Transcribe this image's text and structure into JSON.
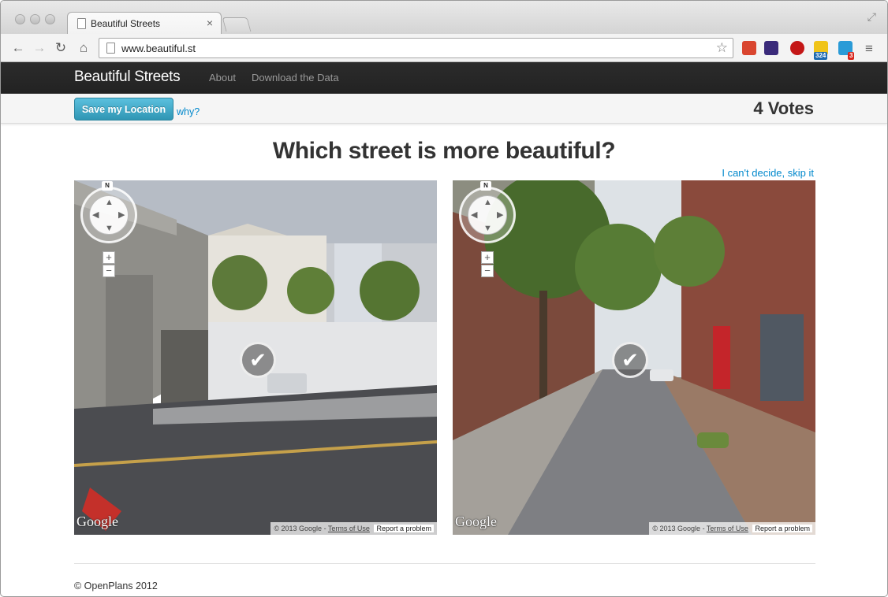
{
  "browser": {
    "tab_title": "Beautiful Streets",
    "tab_close": "×",
    "url": "www.beautiful.st",
    "icons": [
      "back-icon",
      "forward-icon",
      "reload-icon",
      "home-icon",
      "star-icon",
      "menu-icon"
    ],
    "extension_badges": {
      "ext4": "324",
      "ext5": "3"
    }
  },
  "site": {
    "brand": "Beautiful Streets",
    "nav": {
      "about": "About",
      "download": "Download the Data"
    },
    "save_button": "Save my Location",
    "why_link": "why?",
    "votes": "4 Votes",
    "heading": "Which street is more beautiful?",
    "skip_link": "I can't decide, skip it",
    "footer": "© OpenPlans 2012",
    "colors": {
      "navbar": "#222222",
      "link": "#0088cc",
      "button": "#49afcd"
    }
  },
  "panels": {
    "left": {
      "compass_n": "N",
      "google": "Google",
      "copyright": "© 2013 Google -",
      "terms": "Terms of Use",
      "report": "Report a problem"
    },
    "right": {
      "compass_n": "N",
      "google": "Google",
      "copyright": "© 2013 Google -",
      "terms": "Terms of Use",
      "report": "Report a problem"
    }
  }
}
